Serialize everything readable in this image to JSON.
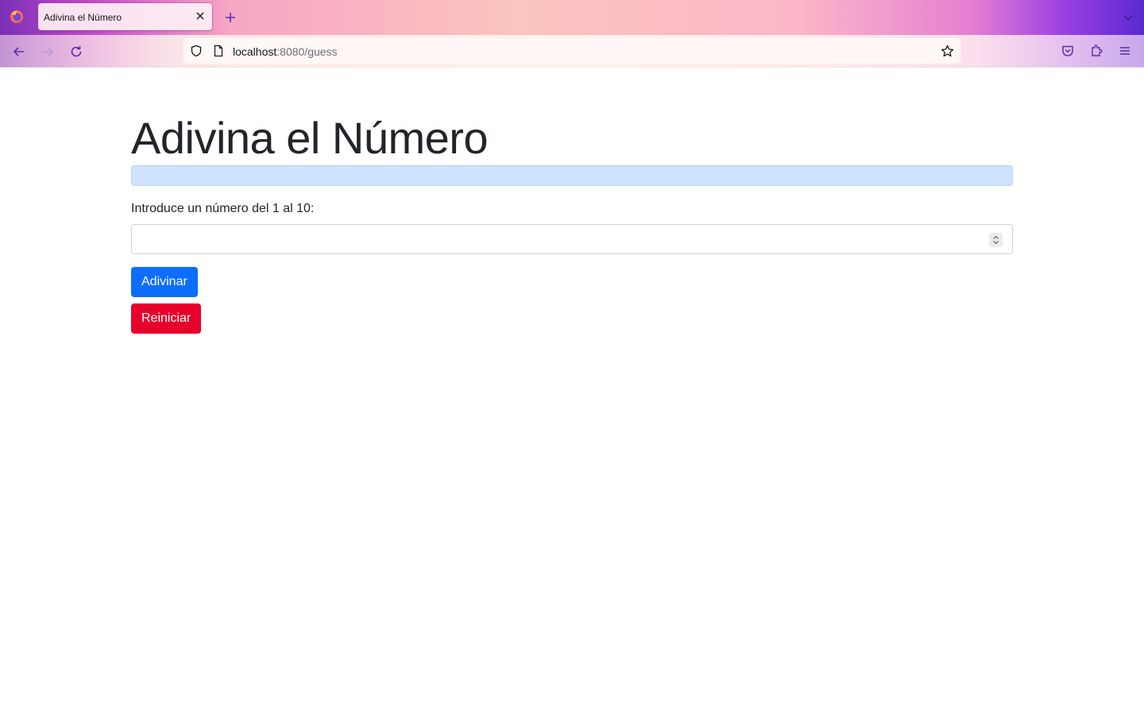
{
  "browser": {
    "tab_title": "Adivina el Número",
    "url_host": "localhost",
    "url_path": ":8080/guess"
  },
  "page": {
    "heading": "Adivina el Número",
    "alert_text": "",
    "input_label": "Introduce un número del 1 al 10:",
    "input_value": "",
    "guess_button": "Adivinar",
    "reset_button": "Reiniciar"
  },
  "colors": {
    "primary": "#0d6efd",
    "danger": "#e8002d",
    "alert_bg": "#cfe2ff"
  },
  "icons": [
    "firefox-logo-icon",
    "close-icon",
    "plus-icon",
    "chevron-down-icon",
    "back-arrow-icon",
    "forward-arrow-icon",
    "reload-icon",
    "shield-icon",
    "page-icon",
    "star-icon",
    "pocket-icon",
    "extensions-icon",
    "hamburger-menu-icon"
  ]
}
